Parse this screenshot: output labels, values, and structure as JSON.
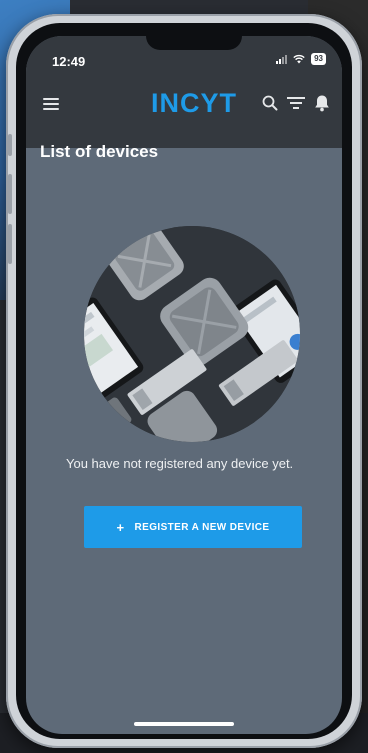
{
  "status_bar": {
    "time": "12:49",
    "battery": "93"
  },
  "header": {
    "brand": "INCYT",
    "icons": [
      "menu-icon",
      "search-icon",
      "filter-icon",
      "bell-icon"
    ]
  },
  "page": {
    "title": "List of devices"
  },
  "empty_state": {
    "message": "You have not registered any device yet.",
    "illustration": "devices-photo",
    "button_label": "REGISTER A NEW DEVICE",
    "button_icon": "plus-icon"
  },
  "colors": {
    "accent": "#1e9be8",
    "header_bg": "#34393f",
    "content_bg": "#5e6a78"
  }
}
